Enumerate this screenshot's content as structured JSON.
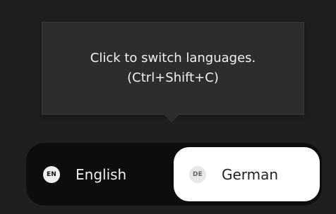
{
  "tooltip": {
    "line1": "Click to switch languages.",
    "line2": "(Ctrl+Shift+C)"
  },
  "language_toggle": {
    "options": [
      {
        "badge": "EN",
        "label": "English",
        "selected": false
      },
      {
        "badge": "DE",
        "label": "German",
        "selected": true
      }
    ]
  },
  "colors": {
    "background": "#1f1f1f",
    "tooltip_bg": "#2d2d2d",
    "toggle_bg": "#0d0d0d",
    "selected_bg": "#ffffff"
  }
}
